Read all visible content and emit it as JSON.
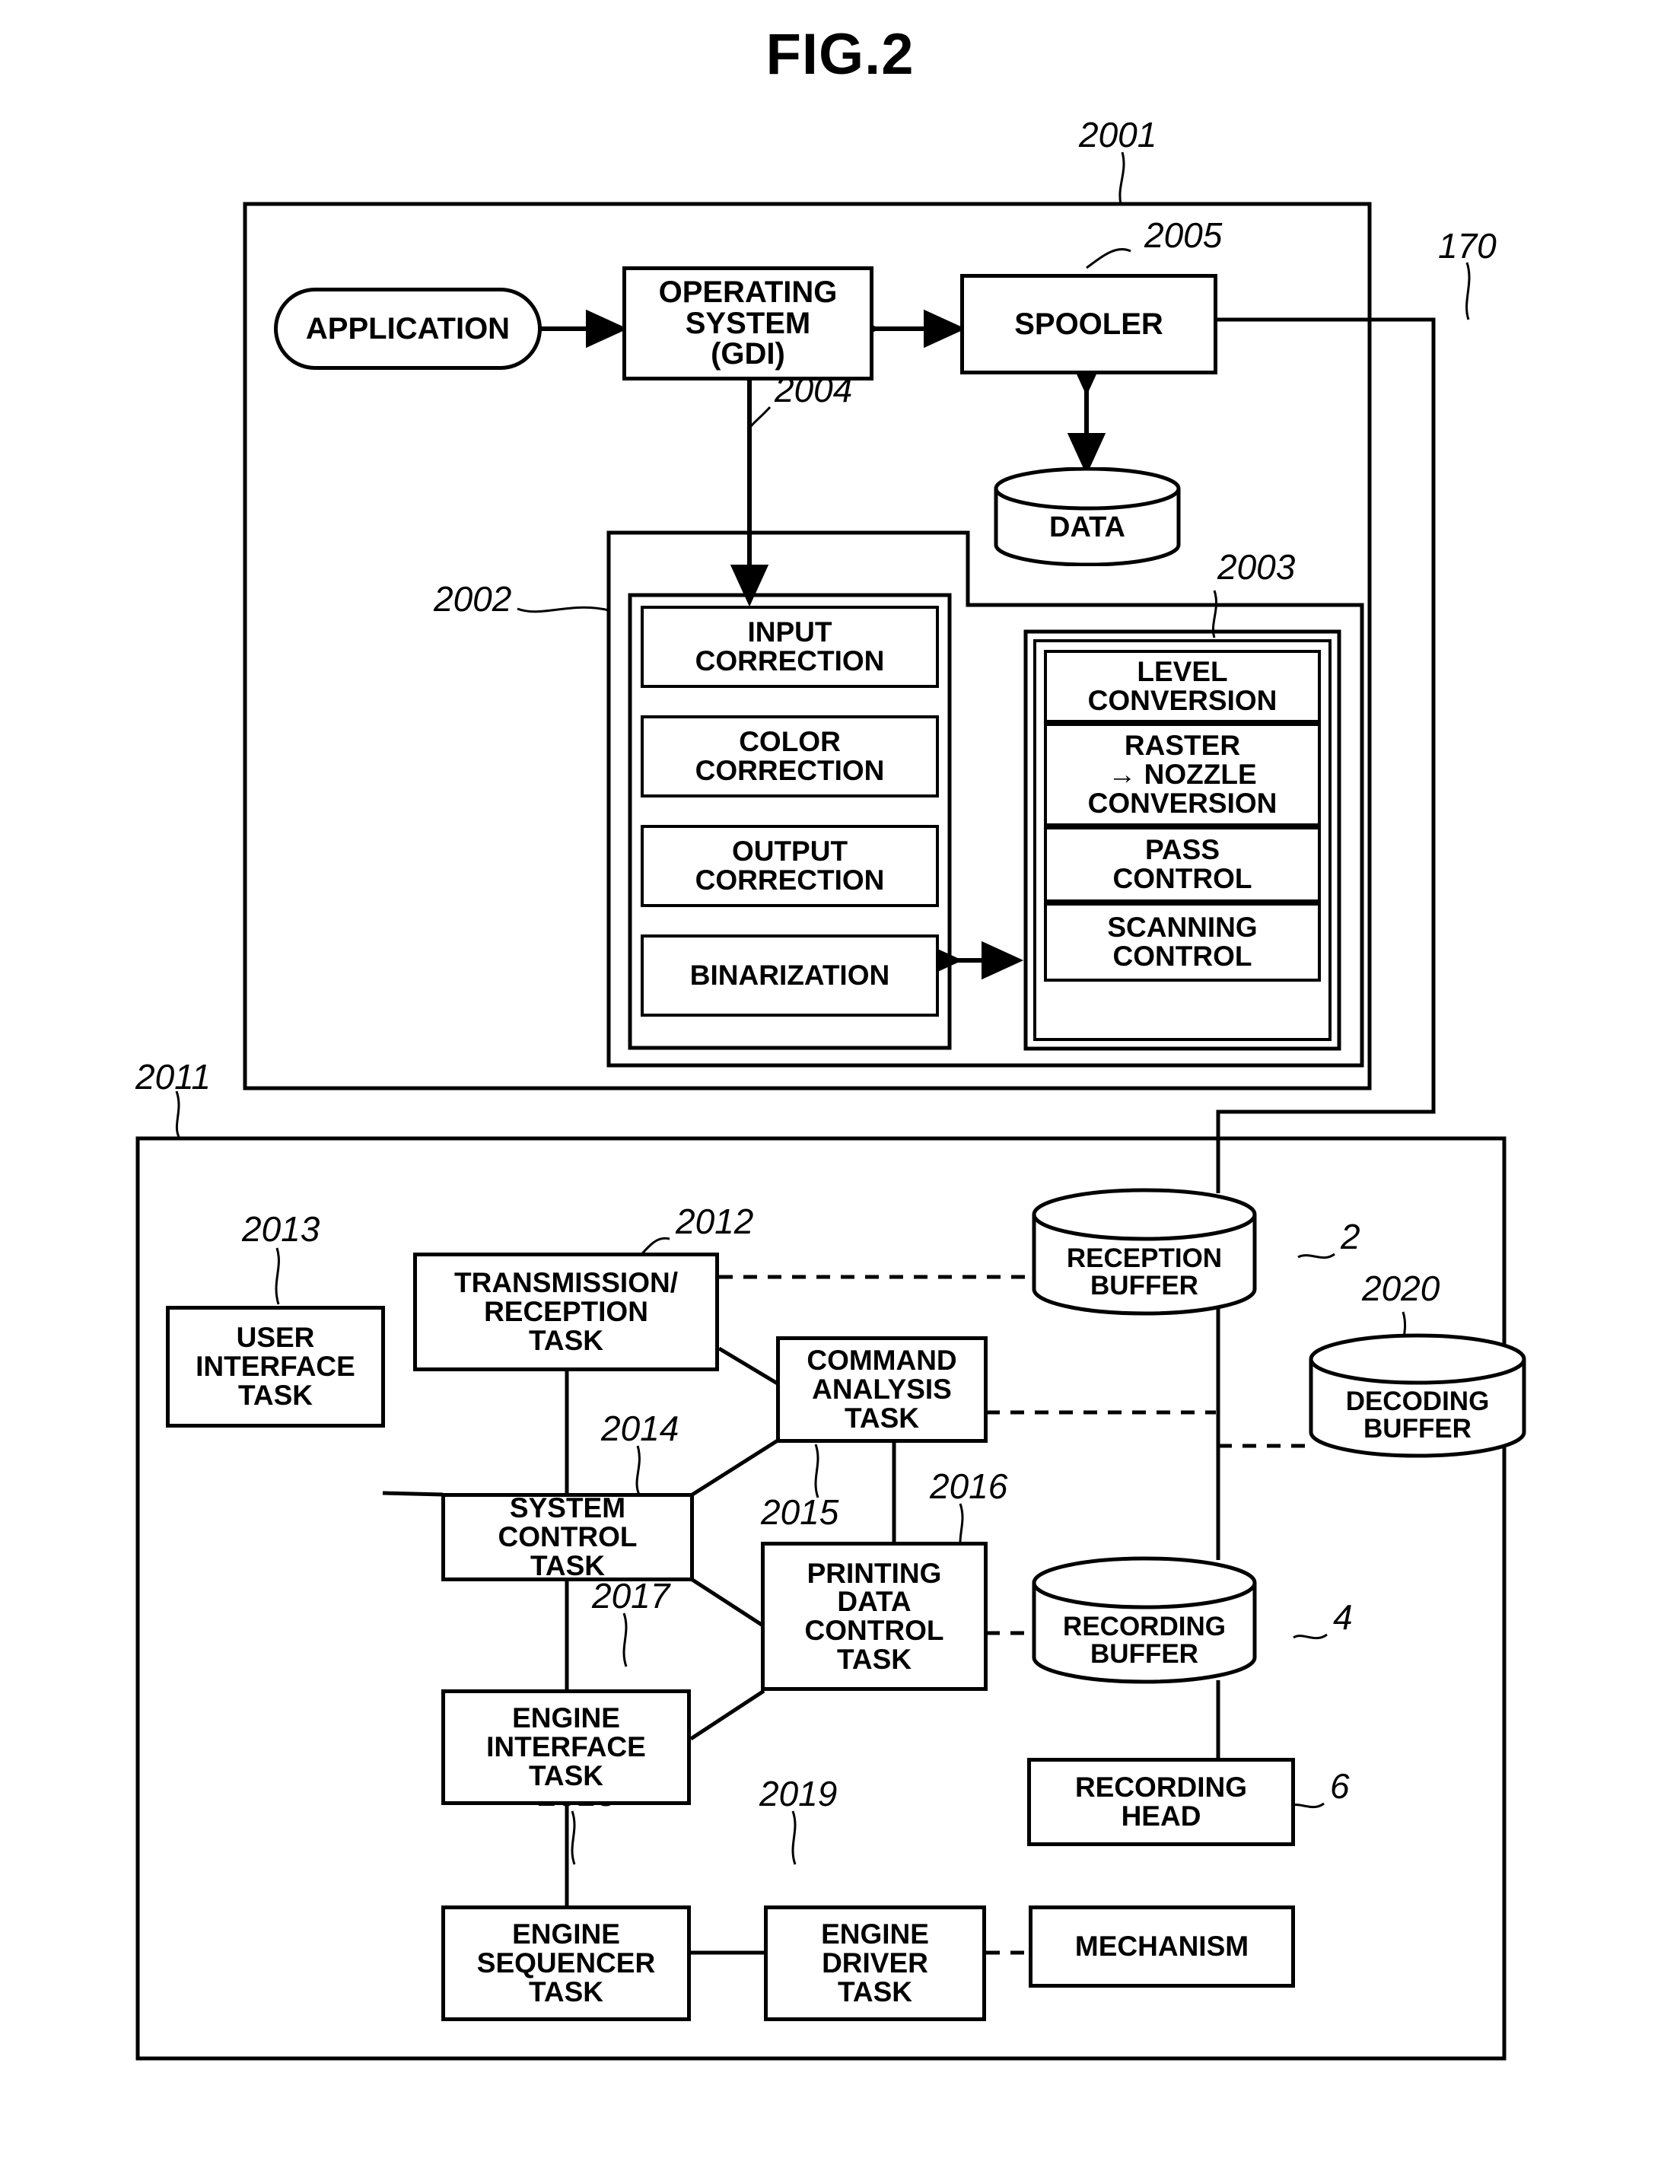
{
  "figure": {
    "title": "FIG.2"
  },
  "host": {
    "ref": "2001",
    "application": "APPLICATION",
    "operating_system": "OPERATING\nSYSTEM\n(GDI)",
    "operating_system_lines": [
      "OPERATING",
      "SYSTEM",
      "(GDI)"
    ],
    "spooler": "SPOOLER",
    "spooler_ref": "2005",
    "data_store": "DATA",
    "os_ref": "2004",
    "interface_ref": "170",
    "image_processing_ref": "2002",
    "print_control_ref": "2003",
    "image_processing_blocks": [
      {
        "lines": [
          "INPUT",
          "CORRECTION"
        ]
      },
      {
        "lines": [
          "COLOR",
          "CORRECTION"
        ]
      },
      {
        "lines": [
          "OUTPUT",
          "CORRECTION"
        ]
      },
      {
        "lines": [
          "BINARIZATION"
        ]
      }
    ],
    "print_control_blocks": [
      {
        "lines": [
          "LEVEL",
          "CONVERSION"
        ]
      },
      {
        "lines": [
          "RASTER",
          "→ NOZZLE",
          "CONVERSION"
        ]
      },
      {
        "lines": [
          "PASS",
          "CONTROL"
        ]
      },
      {
        "lines": [
          "SCANNING",
          "CONTROL"
        ]
      }
    ]
  },
  "printer": {
    "ref": "2011",
    "tasks": [
      {
        "ref": "2012",
        "lines": [
          "TRANSMISSION/",
          "RECEPTION",
          "TASK"
        ]
      },
      {
        "ref": "2013",
        "lines": [
          "USER",
          "INTERFACE",
          "TASK"
        ]
      },
      {
        "ref": "2014",
        "lines": [
          "SYSTEM",
          "CONTROL",
          "TASK"
        ]
      },
      {
        "ref": "2015",
        "lines": [
          "COMMAND",
          "ANALYSIS",
          "TASK"
        ]
      },
      {
        "ref": "2016",
        "lines": [
          "PRINTING",
          "DATA",
          "CONTROL",
          "TASK"
        ]
      },
      {
        "ref": "2017",
        "lines": [
          "ENGINE",
          "INTERFACE",
          "TASK"
        ]
      },
      {
        "ref": "2018",
        "lines": [
          "ENGINE",
          "SEQUENCER",
          "TASK"
        ]
      },
      {
        "ref": "2019",
        "lines": [
          "ENGINE",
          "DRIVER",
          "TASK"
        ]
      }
    ],
    "buffers": [
      {
        "ref": "2",
        "lines": [
          "RECEPTION",
          "BUFFER"
        ]
      },
      {
        "ref": "2020",
        "lines": [
          "DECODING",
          "BUFFER"
        ]
      },
      {
        "ref": "4",
        "lines": [
          "RECORDING",
          "BUFFER"
        ]
      }
    ],
    "recording_head": {
      "ref": "6",
      "lines": [
        "RECORDING",
        "HEAD"
      ]
    },
    "mechanism": {
      "lines": [
        "MECHANISM"
      ]
    }
  },
  "colors": {
    "ink": "#000000",
    "paper": "#ffffff"
  }
}
